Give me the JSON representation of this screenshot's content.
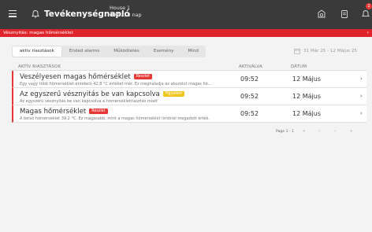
{
  "header": {
    "title": "Tevékenységnapló",
    "house_name": "House 1",
    "house_info": "09:52, 8 nap",
    "alert_count": "2"
  },
  "banner": {
    "text": "Vésznyitás: magas hőmérséklet",
    "chevron": "›"
  },
  "tabs": [
    {
      "label": "aktív riasztások",
      "active": true
    },
    {
      "label": "Ended alarms",
      "active": false
    },
    {
      "label": "Működtetés",
      "active": false
    },
    {
      "label": "Esemény",
      "active": false
    },
    {
      "label": "Mind",
      "active": false
    }
  ],
  "daterange": "31 Már 25 - 12 Május 25",
  "table": {
    "headers": {
      "name": "AKTÍV RIASZTÁSOK",
      "activated": "AKTIVÁLVA",
      "date": "DÁTUM"
    },
    "rows": [
      {
        "title": "Veszélyesen magas hőmérséklet",
        "badge": "Reszlet",
        "badge_color": "#e53935",
        "desc": "Egy vagy több hőmérséklet-érzékelő 42,8 °C értéket mér. Ez meghaladja az abszolút magas hő...",
        "time": "09:52",
        "date": "12 Május",
        "chevron": "›"
      },
      {
        "title": "Az egyszerű vésznyitás be van kapcsolva",
        "badge": "Figyelem",
        "badge_color": "#f0c419",
        "desc": "Az egyszerű vésznyitás be van kapcsolva a hőmérsékletriasztás miatt",
        "time": "09:52",
        "date": "12 Május",
        "chevron": "›"
      },
      {
        "title": "Magas hőmérséklet",
        "badge": "Reszlet",
        "badge_color": "#e53935",
        "desc": "A belső hőmérséklet 39,2 °C. Ez magasabb, mint a magas hőmérséklet limitnél megadott érték.",
        "time": "09:52",
        "date": "12 Május",
        "chevron": "›"
      }
    ]
  },
  "pager": {
    "label": "Page 1 - 1",
    "first": "«",
    "prev": "‹",
    "next": "›",
    "last": "»"
  },
  "colors": {
    "topbar": "#3a3a3a",
    "banner": "#e0242b",
    "accent_red": "#e53935",
    "accent_yellow": "#f0c419"
  },
  "icons": {
    "menu": "hamburger-icon",
    "bell": "bell-icon",
    "alarm": "alarm-icon",
    "calendar": "calendar-icon"
  }
}
